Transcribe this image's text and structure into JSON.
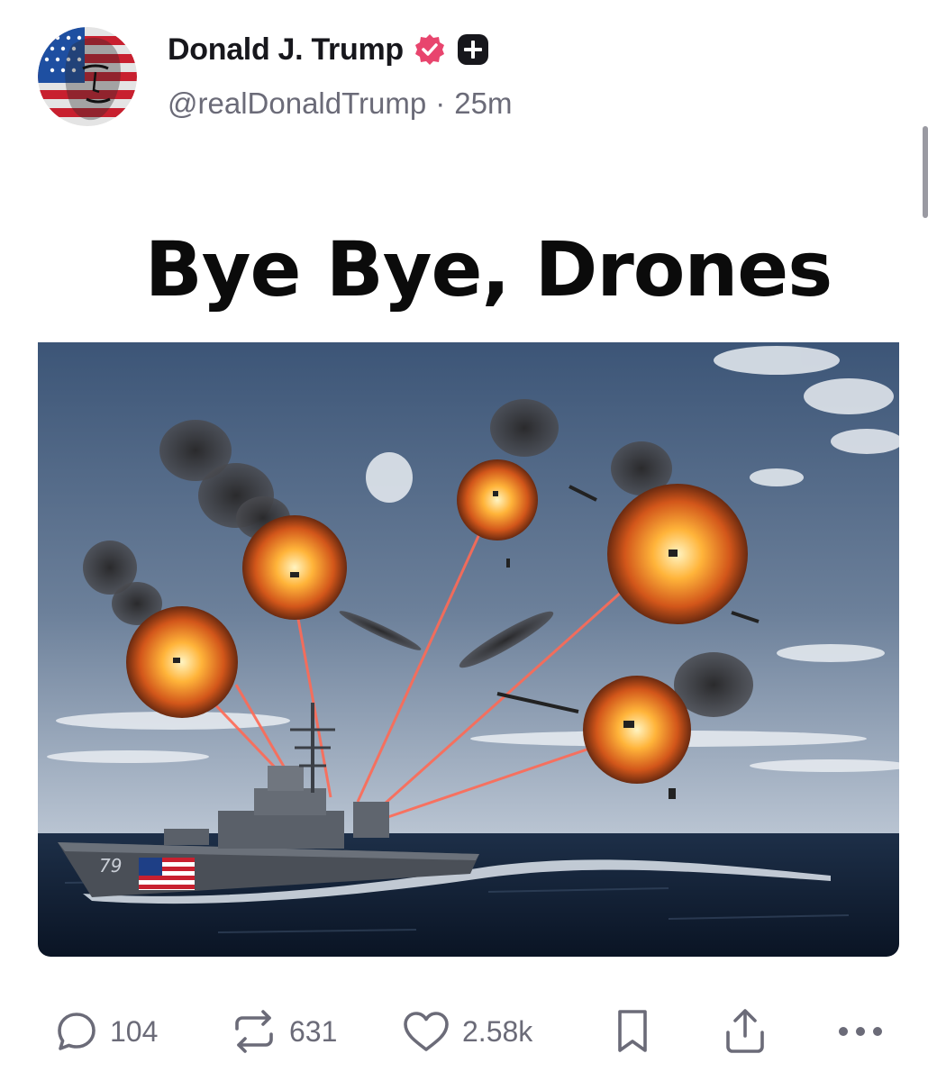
{
  "post": {
    "author": {
      "display_name": "Donald J. Trump",
      "handle": "@realDonaldTrump",
      "separator": "·",
      "time_ago": "25m",
      "verified_badge_color": "#e8456e",
      "plus_badge_color": "#17171c"
    },
    "media": {
      "caption": "Bye Bye, Drones",
      "hull_number": "79",
      "image_description_icon": "warship-firing-lasers-at-exploding-drones"
    },
    "actions": {
      "replies": {
        "count": "104",
        "icon": "reply-icon"
      },
      "reposts": {
        "count": "631",
        "icon": "repost-icon"
      },
      "likes": {
        "count": "2.58k",
        "icon": "heart-icon"
      },
      "bookmark": {
        "icon": "bookmark-icon"
      },
      "share": {
        "icon": "share-icon"
      },
      "more": {
        "icon": "more-icon"
      }
    }
  },
  "colors": {
    "text_primary": "#17171c",
    "text_secondary": "#6b6b78",
    "laser": "#ff6a55",
    "sea": "#0f1e33",
    "sky_top": "#3d5577",
    "sky_bottom": "#b8c4d4"
  }
}
